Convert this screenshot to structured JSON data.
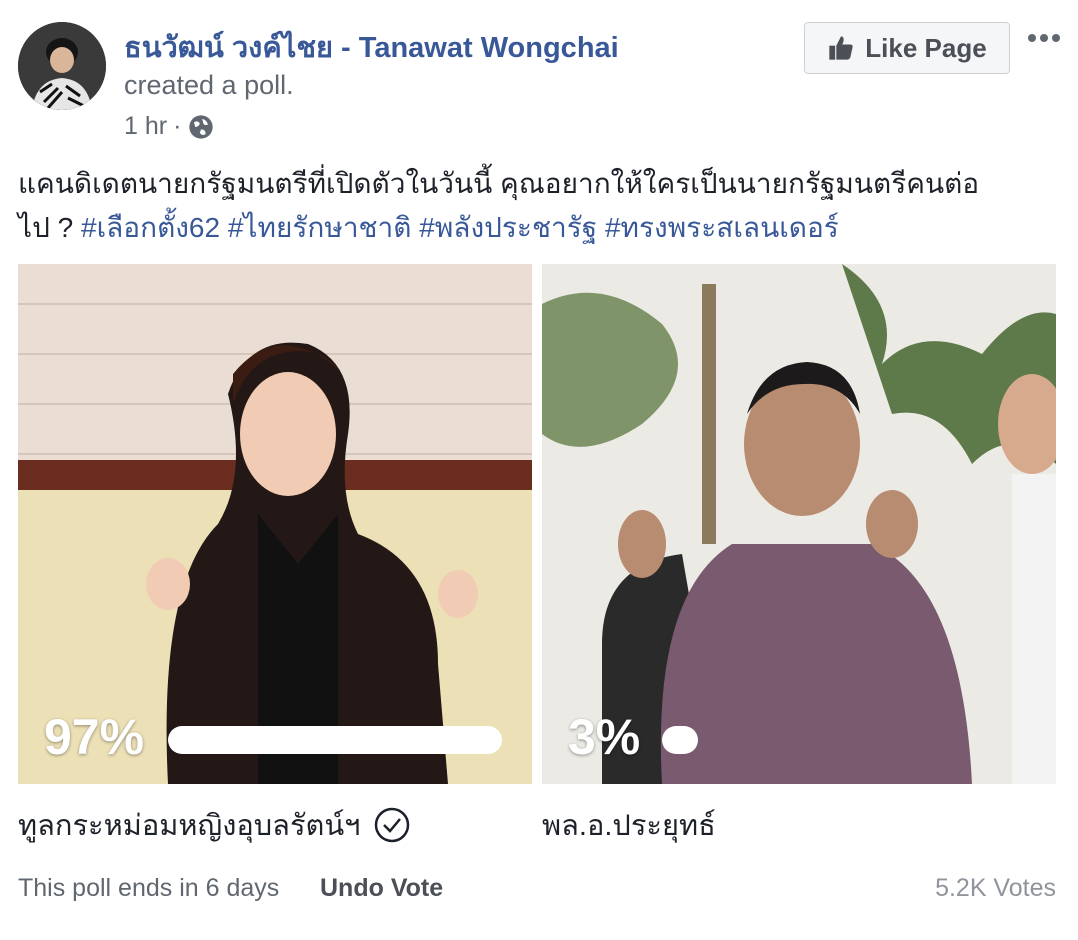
{
  "post": {
    "author": "ธนวัฒน์ วงค์ไชย - Tanawat Wongchai",
    "action": "created a poll.",
    "time": "1 hr",
    "separator": "·",
    "privacy_icon": "globe-icon",
    "like_page_label": "Like Page",
    "text_line1": "แคนดิเดตนายกรัฐมนตรีที่เปิดตัวในวันนี้ คุณอยากให้ใครเป็นนายกรัฐมนตรีคนต่อ",
    "text_line2_prefix": "ไป ?",
    "hashtags": [
      "#เลือกตั้ง62",
      "#ไทยรักษาชาติ",
      "#พลังประชารัฐ",
      "#ทรงพระสเลนเดอร์"
    ]
  },
  "poll": {
    "options": [
      {
        "label": "ทูลกระหม่อมหญิงอุบลรัตน์ฯ",
        "percent_text": "97%",
        "fraction": 0.97,
        "voted": true
      },
      {
        "label": "พล.อ.ประยุทธ์",
        "percent_text": "3%",
        "fraction": 0.03,
        "voted": false
      }
    ],
    "ends_text": "This poll ends in 6 days",
    "undo_label": "Undo Vote",
    "votes_text": "5.2K Votes"
  },
  "colors": {
    "link": "#385898",
    "secondary_text": "#606770",
    "muted": "#90949c"
  }
}
